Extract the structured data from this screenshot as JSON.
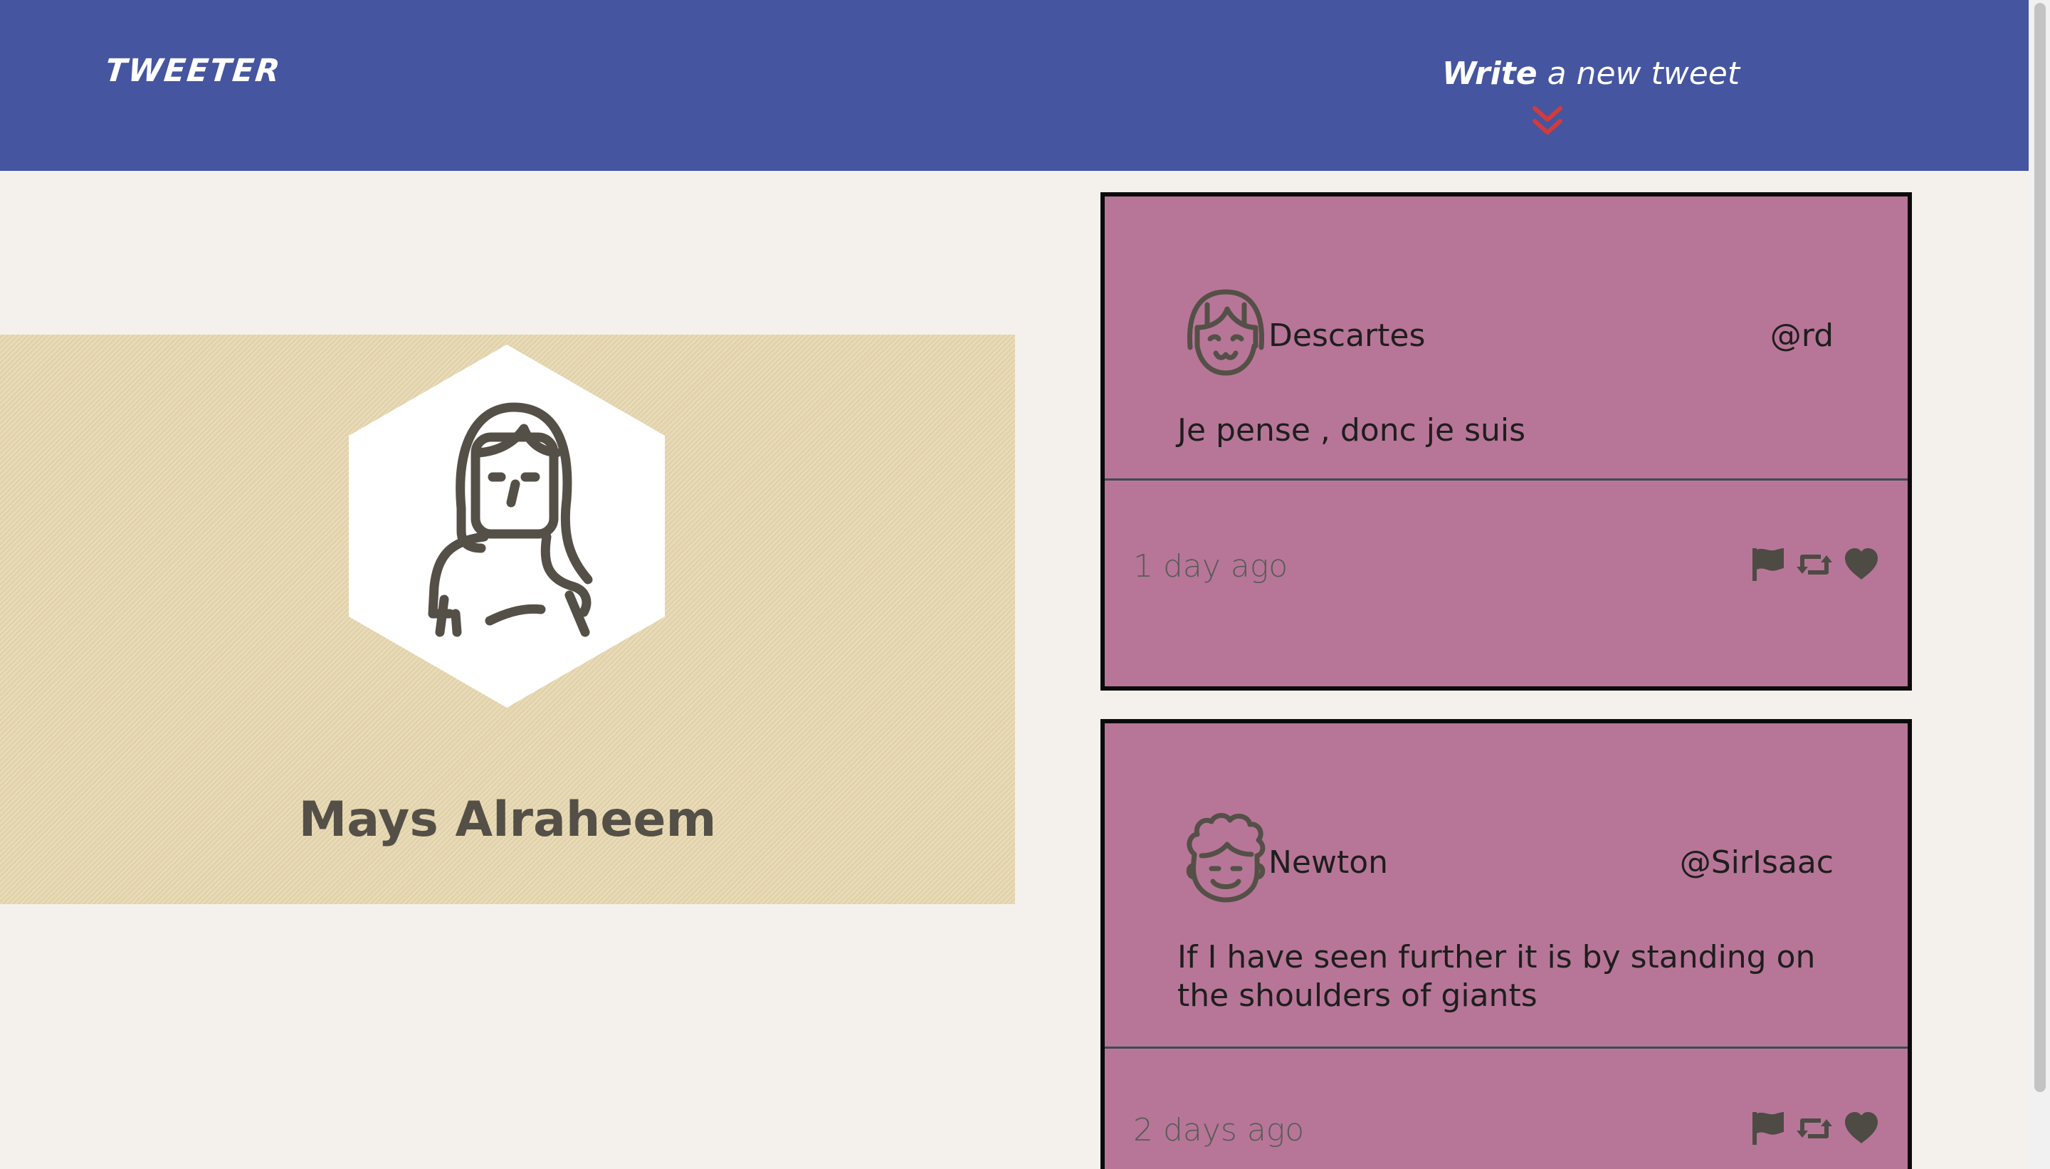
{
  "nav": {
    "brand": "TWEETER",
    "compose_bold": "Write",
    "compose_rest": " a new tweet",
    "accent_color": "#d33b3b",
    "background": "#4555a0"
  },
  "profile": {
    "name": "Mays Alraheem",
    "avatar_icon": "woman-avatar-icon"
  },
  "tweets": [
    {
      "name": "Descartes",
      "handle": "@rd",
      "text": "Je pense , donc je suis",
      "time": "1 day ago",
      "avatar_icon": "girl-avatar-icon"
    },
    {
      "name": "Newton",
      "handle": "@SirIsaac",
      "text": "If I have seen further it is by standing on the shoulders of giants",
      "time": "2 days ago",
      "avatar_icon": "curly-hair-avatar-icon"
    }
  ],
  "actions": {
    "flag_icon": "flag-icon",
    "retweet_icon": "retweet-icon",
    "like_icon": "heart-icon"
  },
  "colors": {
    "tweet_background": "#b77697",
    "profile_background": "#e8d9b2",
    "page_background": "#f4f1ec"
  }
}
